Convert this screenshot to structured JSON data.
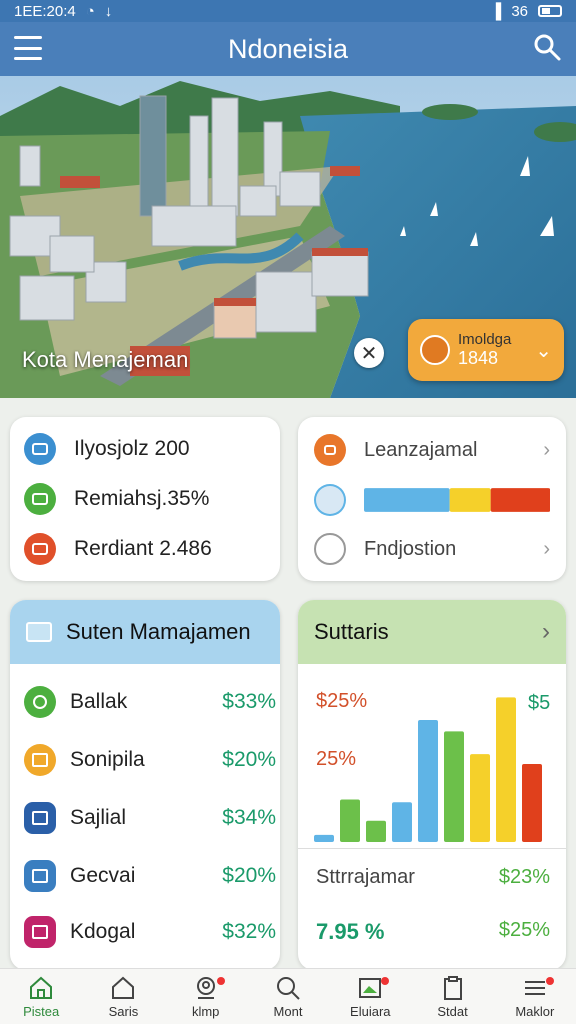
{
  "status": {
    "time": "1EE:20:4",
    "network": "36"
  },
  "appbar": {
    "title": "Ndoneisia"
  },
  "hero": {
    "caption": "Kota Menajeman",
    "info": {
      "label": "Imoldga",
      "value": "1848"
    }
  },
  "stats": [
    {
      "text": "Ilyosjolz 200",
      "color": "#3b8fd0",
      "icon": "document-icon"
    },
    {
      "text": "Remiahsj.35%",
      "color": "#4caf3f",
      "icon": "cash-icon"
    },
    {
      "text": "Rerdiant 2.486",
      "color": "#e0502a",
      "icon": "chat-icon"
    }
  ],
  "links": [
    {
      "label": "Leanzajamal",
      "color": "#e8762a",
      "icon": "cake-icon"
    },
    {
      "label": "Fndjostion",
      "color": "#999999",
      "icon": "gear-icon"
    }
  ],
  "progress": {
    "segments": [
      {
        "value": 0.46,
        "color": "#5fb4e6"
      },
      {
        "value": 0.22,
        "color": "#f5d02a"
      },
      {
        "value": 0.32,
        "color": "#e0401c"
      }
    ]
  },
  "left_panel": {
    "title": "Suten Mamajamen",
    "items": [
      {
        "name": "Ballak",
        "value": "$33%",
        "color": "#4caf3f",
        "icon": "pin-icon"
      },
      {
        "name": "Sonipila",
        "value": "$20%",
        "color": "#f0a82a",
        "icon": "mail-icon"
      },
      {
        "name": "Sajlial",
        "value": "$34%",
        "color": "#2a5fa8",
        "icon": "register-icon"
      },
      {
        "name": "Gecvai",
        "value": "$20%",
        "color": "#3a7ec0",
        "icon": "checkbox-icon"
      },
      {
        "name": "Kdogal",
        "value": "$32%",
        "color": "#c0246a",
        "icon": "list-icon"
      }
    ]
  },
  "right_panel": {
    "title": "Suttaris",
    "chart_data": {
      "type": "bar",
      "bars": [
        {
          "value": 5,
          "color": "#5fb4e6"
        },
        {
          "value": 30,
          "color": "#6cc04a"
        },
        {
          "value": 15,
          "color": "#6cc04a"
        },
        {
          "value": 28,
          "color": "#5fb4e6"
        },
        {
          "value": 86,
          "color": "#5fb4e6"
        },
        {
          "value": 78,
          "color": "#6cc04a"
        },
        {
          "value": 62,
          "color": "#f5d02a"
        },
        {
          "value": 102,
          "color": "#f5d02a"
        },
        {
          "value": 55,
          "color": "#e0401c"
        }
      ],
      "labels": {
        "top_left": "$25%",
        "mid_left": "25%",
        "top_right": "$5"
      }
    },
    "footer": [
      {
        "label": "Sttrrajamar",
        "value": "$23%"
      },
      {
        "label": "7.95 %",
        "value": "$25%"
      }
    ]
  },
  "bottom_nav": [
    {
      "label": "Pistea",
      "icon": "home-icon",
      "active": true
    },
    {
      "label": "Saris",
      "icon": "house-icon",
      "active": false
    },
    {
      "label": "klmp",
      "icon": "user-icon",
      "active": false,
      "badge": true
    },
    {
      "label": "Mont",
      "icon": "search-icon",
      "active": false
    },
    {
      "label": "Eluiara",
      "icon": "image-icon",
      "active": false,
      "badge": true
    },
    {
      "label": "Stdat",
      "icon": "clipboard-icon",
      "active": false
    },
    {
      "label": "Maklor",
      "icon": "menu-icon",
      "active": false,
      "badge": true
    }
  ]
}
